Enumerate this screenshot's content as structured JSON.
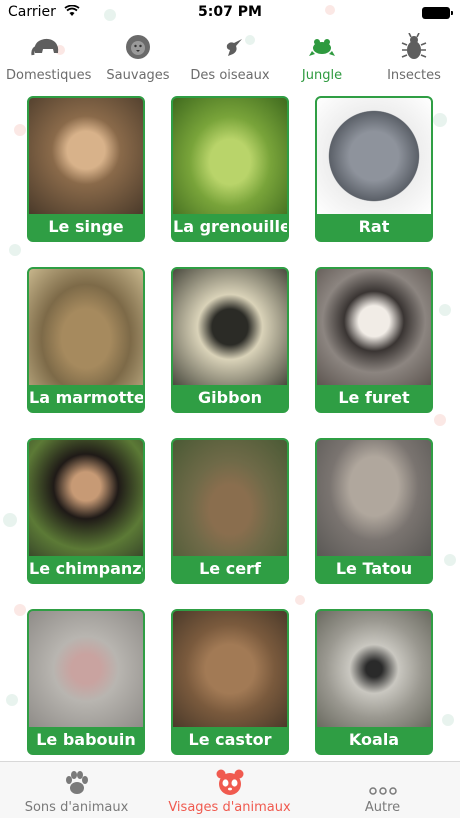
{
  "status_bar": {
    "carrier": "Carrier",
    "time": "5:07 PM"
  },
  "categories": [
    {
      "label": "Domestiques",
      "icon": "elephant-icon"
    },
    {
      "label": "Sauvages",
      "icon": "lion-icon"
    },
    {
      "label": "Des oiseaux",
      "icon": "hummingbird-icon"
    },
    {
      "label": "Jungle",
      "icon": "frog-icon",
      "active": true
    },
    {
      "label": "Insectes",
      "icon": "beetle-icon"
    }
  ],
  "animals": [
    {
      "name": "Le singe",
      "photo_color": "#8a6a4a"
    },
    {
      "name": "La grenouille",
      "photo_color": "#79a43a"
    },
    {
      "name": "Rat",
      "photo_color": "#6b6f78"
    },
    {
      "name": "La marmotte",
      "photo_color": "#7d6a48"
    },
    {
      "name": "Gibbon",
      "photo_color": "#4a4a3f"
    },
    {
      "name": "Le furet",
      "photo_color": "#5d5550"
    },
    {
      "name": "Le chimpanzé",
      "photo_color": "#3a4a2a"
    },
    {
      "name": "Le cerf",
      "photo_color": "#6f6a48"
    },
    {
      "name": "Le Tatou",
      "photo_color": "#7a7470"
    },
    {
      "name": "Le babouin",
      "photo_color": "#8f8c88"
    },
    {
      "name": "Le castor",
      "photo_color": "#7a5a3d"
    },
    {
      "name": "Koala",
      "photo_color": "#9a9890"
    }
  ],
  "tabs": [
    {
      "label": "Sons d'animaux",
      "icon": "paw-icon"
    },
    {
      "label": "Visages d'animaux",
      "icon": "panda-icon",
      "active": true
    },
    {
      "label": "Autre",
      "icon": "more-icon"
    }
  ],
  "colors": {
    "accent_green": "#2f9e44",
    "active_tab": "#f05a4f"
  }
}
